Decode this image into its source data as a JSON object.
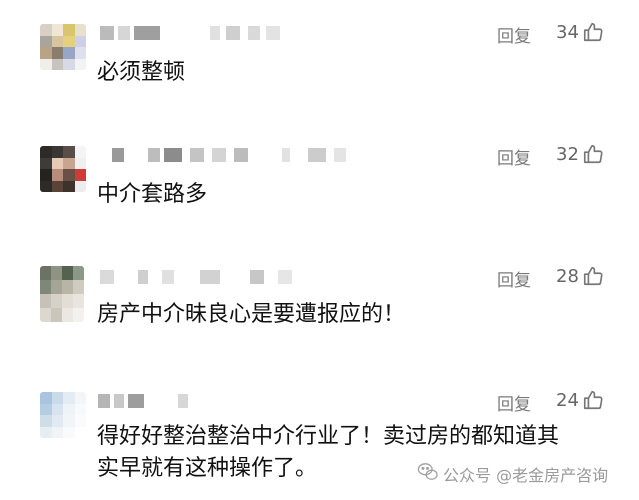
{
  "comments": [
    {
      "reply_label": "回复",
      "likes": "34",
      "text": "必须整顿"
    },
    {
      "reply_label": "回复",
      "likes": "32",
      "text": "中介套路多"
    },
    {
      "reply_label": "回复",
      "likes": "28",
      "text": "房产中介昧良心是要遭报应的！"
    },
    {
      "reply_label": "回复",
      "likes": "24",
      "text_line1": "得好好整治整治中介行业了！卖过房的都知道其",
      "text_line2": "实早就有这种操作了。"
    }
  ],
  "watermark": {
    "text": "公众号 @老金房产咨询"
  },
  "icons": {
    "like": "thumbs-up-icon",
    "watermark": "wechat-icon"
  }
}
